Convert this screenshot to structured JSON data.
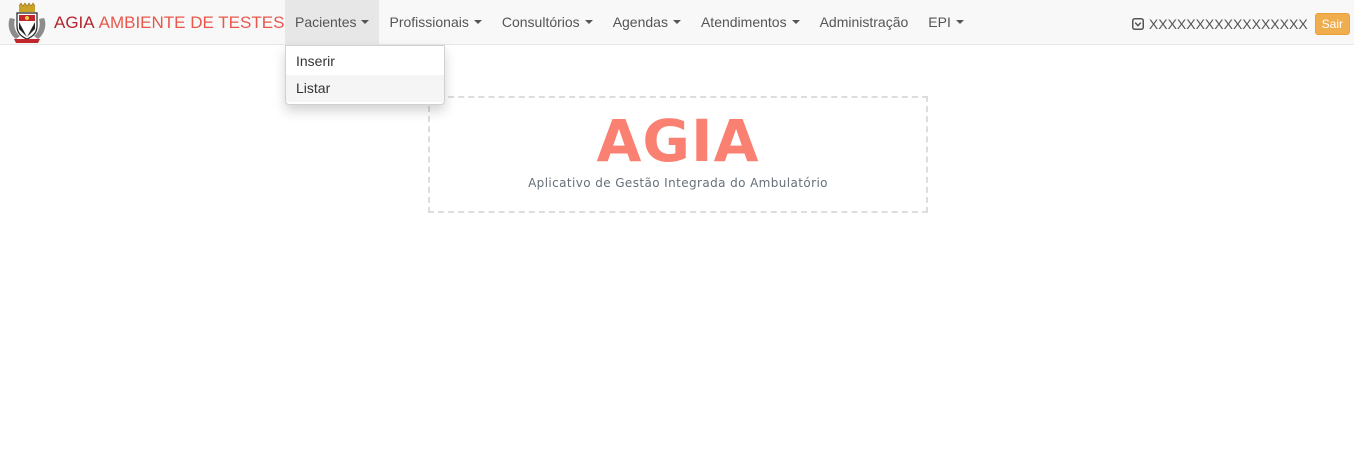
{
  "navbar": {
    "brand": {
      "name": "AGIA",
      "environment": "AMBIENTE DE TESTES",
      "logo_icon": "coat-of-arms-icon"
    },
    "menu": [
      {
        "label": "Pacientes",
        "has_dropdown": true,
        "active": true
      },
      {
        "label": "Profissionais",
        "has_dropdown": true
      },
      {
        "label": "Consultórios",
        "has_dropdown": true
      },
      {
        "label": "Agendas",
        "has_dropdown": true
      },
      {
        "label": "Atendimentos",
        "has_dropdown": true
      },
      {
        "label": "Administração",
        "has_dropdown": false
      },
      {
        "label": "EPI",
        "has_dropdown": true
      }
    ],
    "user": {
      "icon": "user-square-icon",
      "name": "XXXXXXXXXXXXXXXXX",
      "logout_label": "Sair"
    }
  },
  "dropdown": {
    "items": [
      {
        "label": "Inserir"
      },
      {
        "label": "Listar"
      }
    ]
  },
  "hero": {
    "title": "AGIA",
    "subtitle": "Aplicativo de Gestão Integrada do Ambulatório"
  },
  "colors": {
    "brand_name": "#b3262f",
    "brand_env": "#e8574b",
    "hero_title": "#fa8072",
    "logout_button": "#f0ad4e"
  }
}
